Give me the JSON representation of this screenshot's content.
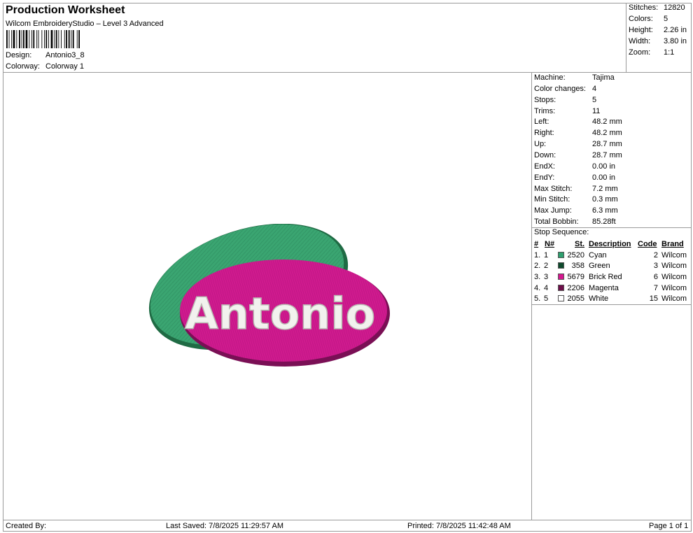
{
  "header": {
    "title": "Production Worksheet",
    "subtitle": "Wilcom EmbroideryStudio – Level 3 Advanced",
    "design_label": "Design:",
    "design_value": "Antonio3_8",
    "colorway_label": "Colorway:",
    "colorway_value": "Colorway 1"
  },
  "summary": [
    {
      "label": "Stitches:",
      "value": "12820"
    },
    {
      "label": "Colors:",
      "value": "5"
    },
    {
      "label": "Height:",
      "value": "2.26 in"
    },
    {
      "label": "Width:",
      "value": "3.80 in"
    },
    {
      "label": "Zoom:",
      "value": "1:1"
    }
  ],
  "stats": [
    {
      "label": "Machine:",
      "value": "Tajima"
    },
    {
      "label": "Color changes:",
      "value": "4"
    },
    {
      "label": "Stops:",
      "value": "5"
    },
    {
      "label": "Trims:",
      "value": "11"
    },
    {
      "label": "Left:",
      "value": "48.2 mm"
    },
    {
      "label": "Right:",
      "value": "48.2 mm"
    },
    {
      "label": "Up:",
      "value": "28.7 mm"
    },
    {
      "label": "Down:",
      "value": "28.7 mm"
    },
    {
      "label": "EndX:",
      "value": "0.00 in"
    },
    {
      "label": "EndY:",
      "value": "0.00 in"
    },
    {
      "label": "Max Stitch:",
      "value": "7.2 mm"
    },
    {
      "label": "Min Stitch:",
      "value": "0.3 mm"
    },
    {
      "label": "Max Jump:",
      "value": "6.3 mm"
    },
    {
      "label": "Total Bobbin:",
      "value": "85.28ft"
    }
  ],
  "stop_sequence": {
    "title": "Stop Sequence:",
    "columns": [
      "#",
      "N#",
      "St.",
      "Description",
      "Code",
      "Brand"
    ],
    "rows": [
      {
        "num": "1.",
        "n": "1",
        "color": "#2e9f6e",
        "st": "2520",
        "desc": "Cyan",
        "code": "2",
        "brand": "Wilcom"
      },
      {
        "num": "2.",
        "n": "2",
        "color": "#0e4a2c",
        "st": "358",
        "desc": "Green",
        "code": "3",
        "brand": "Wilcom"
      },
      {
        "num": "3.",
        "n": "3",
        "color": "#d4178f",
        "st": "5679",
        "desc": "Brick Red",
        "code": "6",
        "brand": "Wilcom"
      },
      {
        "num": "4.",
        "n": "4",
        "color": "#6e0f4a",
        "st": "2206",
        "desc": "Magenta",
        "code": "7",
        "brand": "Wilcom"
      },
      {
        "num": "5.",
        "n": "5",
        "color": "#ffffff",
        "st": "2055",
        "desc": "White",
        "code": "15",
        "brand": "Wilcom"
      }
    ]
  },
  "design_preview": {
    "text": "Antonio",
    "colors": {
      "green": "#3aa571",
      "green_dark": "#1f6b44",
      "pink": "#cf1a8e",
      "pink_dark": "#7a0f55",
      "white": "#f2f2ee"
    }
  },
  "footer": {
    "created_by": "Created By:",
    "last_saved": "Last Saved: 7/8/2025 11:29:57 AM",
    "printed": "Printed: 7/8/2025 11:42:48 AM",
    "page": "Page 1 of 1"
  }
}
